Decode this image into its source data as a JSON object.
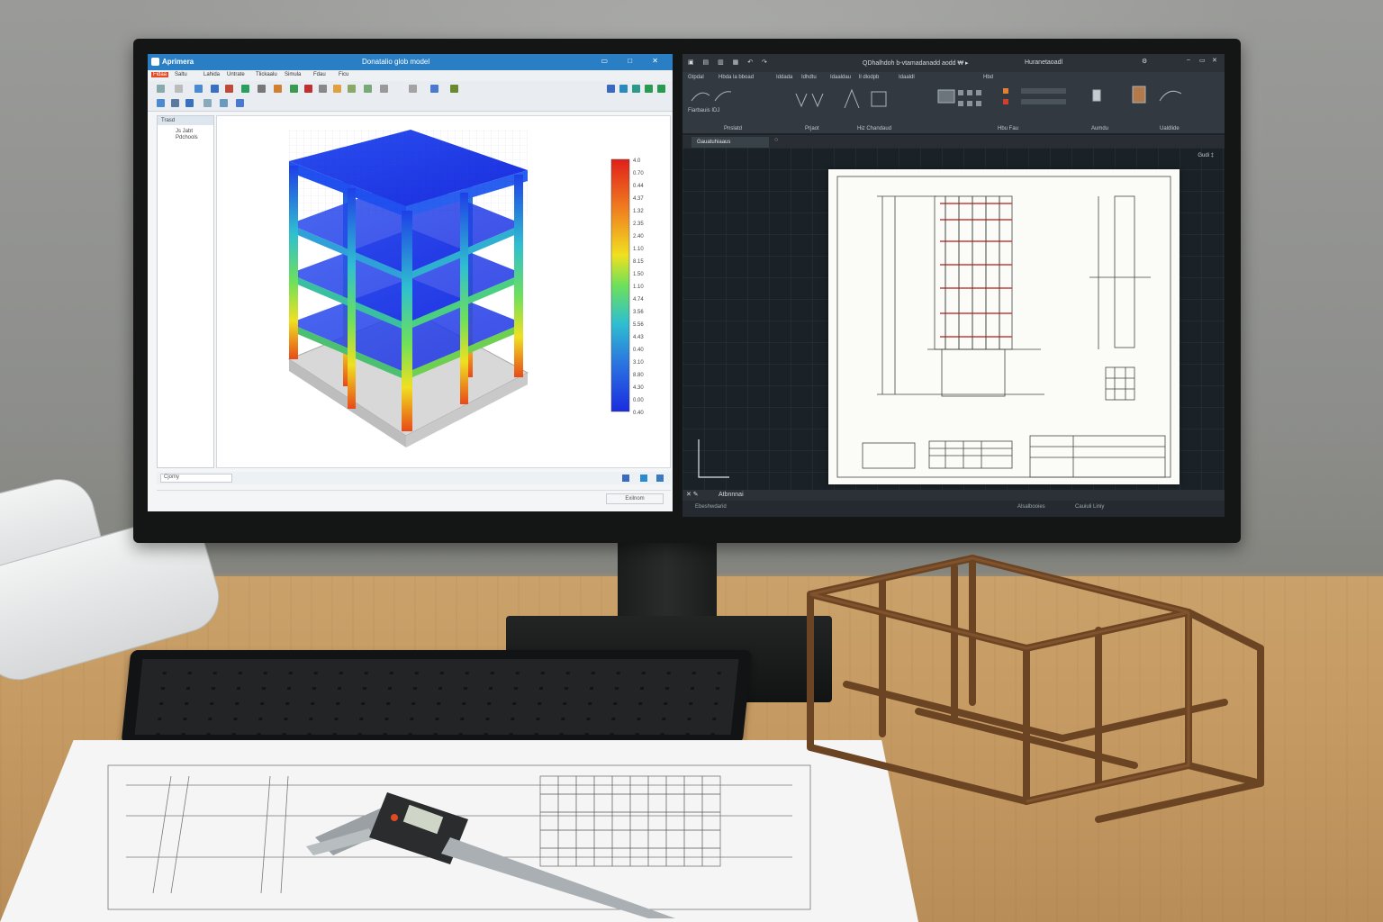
{
  "left_app": {
    "title": "Aprimera",
    "document": "Donatalio  glob  model",
    "window_controls": "▭ □ ✕",
    "menu": [
      "Fidaa",
      "Saltu",
      "Lahida",
      "Untrate",
      "Tlickaalu",
      "Simula",
      "Fdau",
      "Ficu"
    ],
    "panel_header": "Trasd",
    "panel_items": [
      "Js Jabt",
      "Pdchools"
    ],
    "status_field": "Cjomy",
    "bottom_button": "Exilnom",
    "legend_values": [
      "4.0",
      "0.70",
      "0.44",
      "4.37",
      "1.32",
      "2.35",
      "2.40",
      "1.10",
      "8.15",
      "1.50",
      "1.10",
      "4.74",
      "3.56",
      "5.56",
      "4.43",
      "0.40",
      "3.10",
      "8.80",
      "4.30",
      "0.00",
      "0.40"
    ],
    "colors": {
      "title_bar": "#2a7fc4",
      "high": "#e0201a",
      "mid": "#f0e020",
      "low": "#1a2ce0"
    }
  },
  "right_app": {
    "title": "QDhalhdoh  b-vtamadanadd  aodd   ₩ ▸",
    "search_box": "Huranetaoadl",
    "tabs": [
      "Gtpdal",
      "Hbda  la  bboad",
      "Iddada",
      "Idhdtu",
      "Idaaldau",
      "  ll  dlodpb",
      "Idaaldl",
      "Hbd"
    ],
    "groups": [
      "Fiarbauis  IDJ",
      "Pnslatd",
      "Prjaot",
      "Hiz  Chandaud",
      "Hbu  Fau",
      "Aumdu",
      "Ualdlide"
    ],
    "doc_tab": "Gauatuhiaaus",
    "view_label": "Gudi ‡",
    "command": "Atbnnnai",
    "status_left": "Ebeshwdarid",
    "status_right": [
      "Alsalbooies",
      "Cauiuli Liniy"
    ]
  },
  "icons": [
    "app-logo-icon",
    "minimize-icon",
    "maximize-icon",
    "close-icon",
    "ucs-axis-icon",
    "gear-icon"
  ]
}
